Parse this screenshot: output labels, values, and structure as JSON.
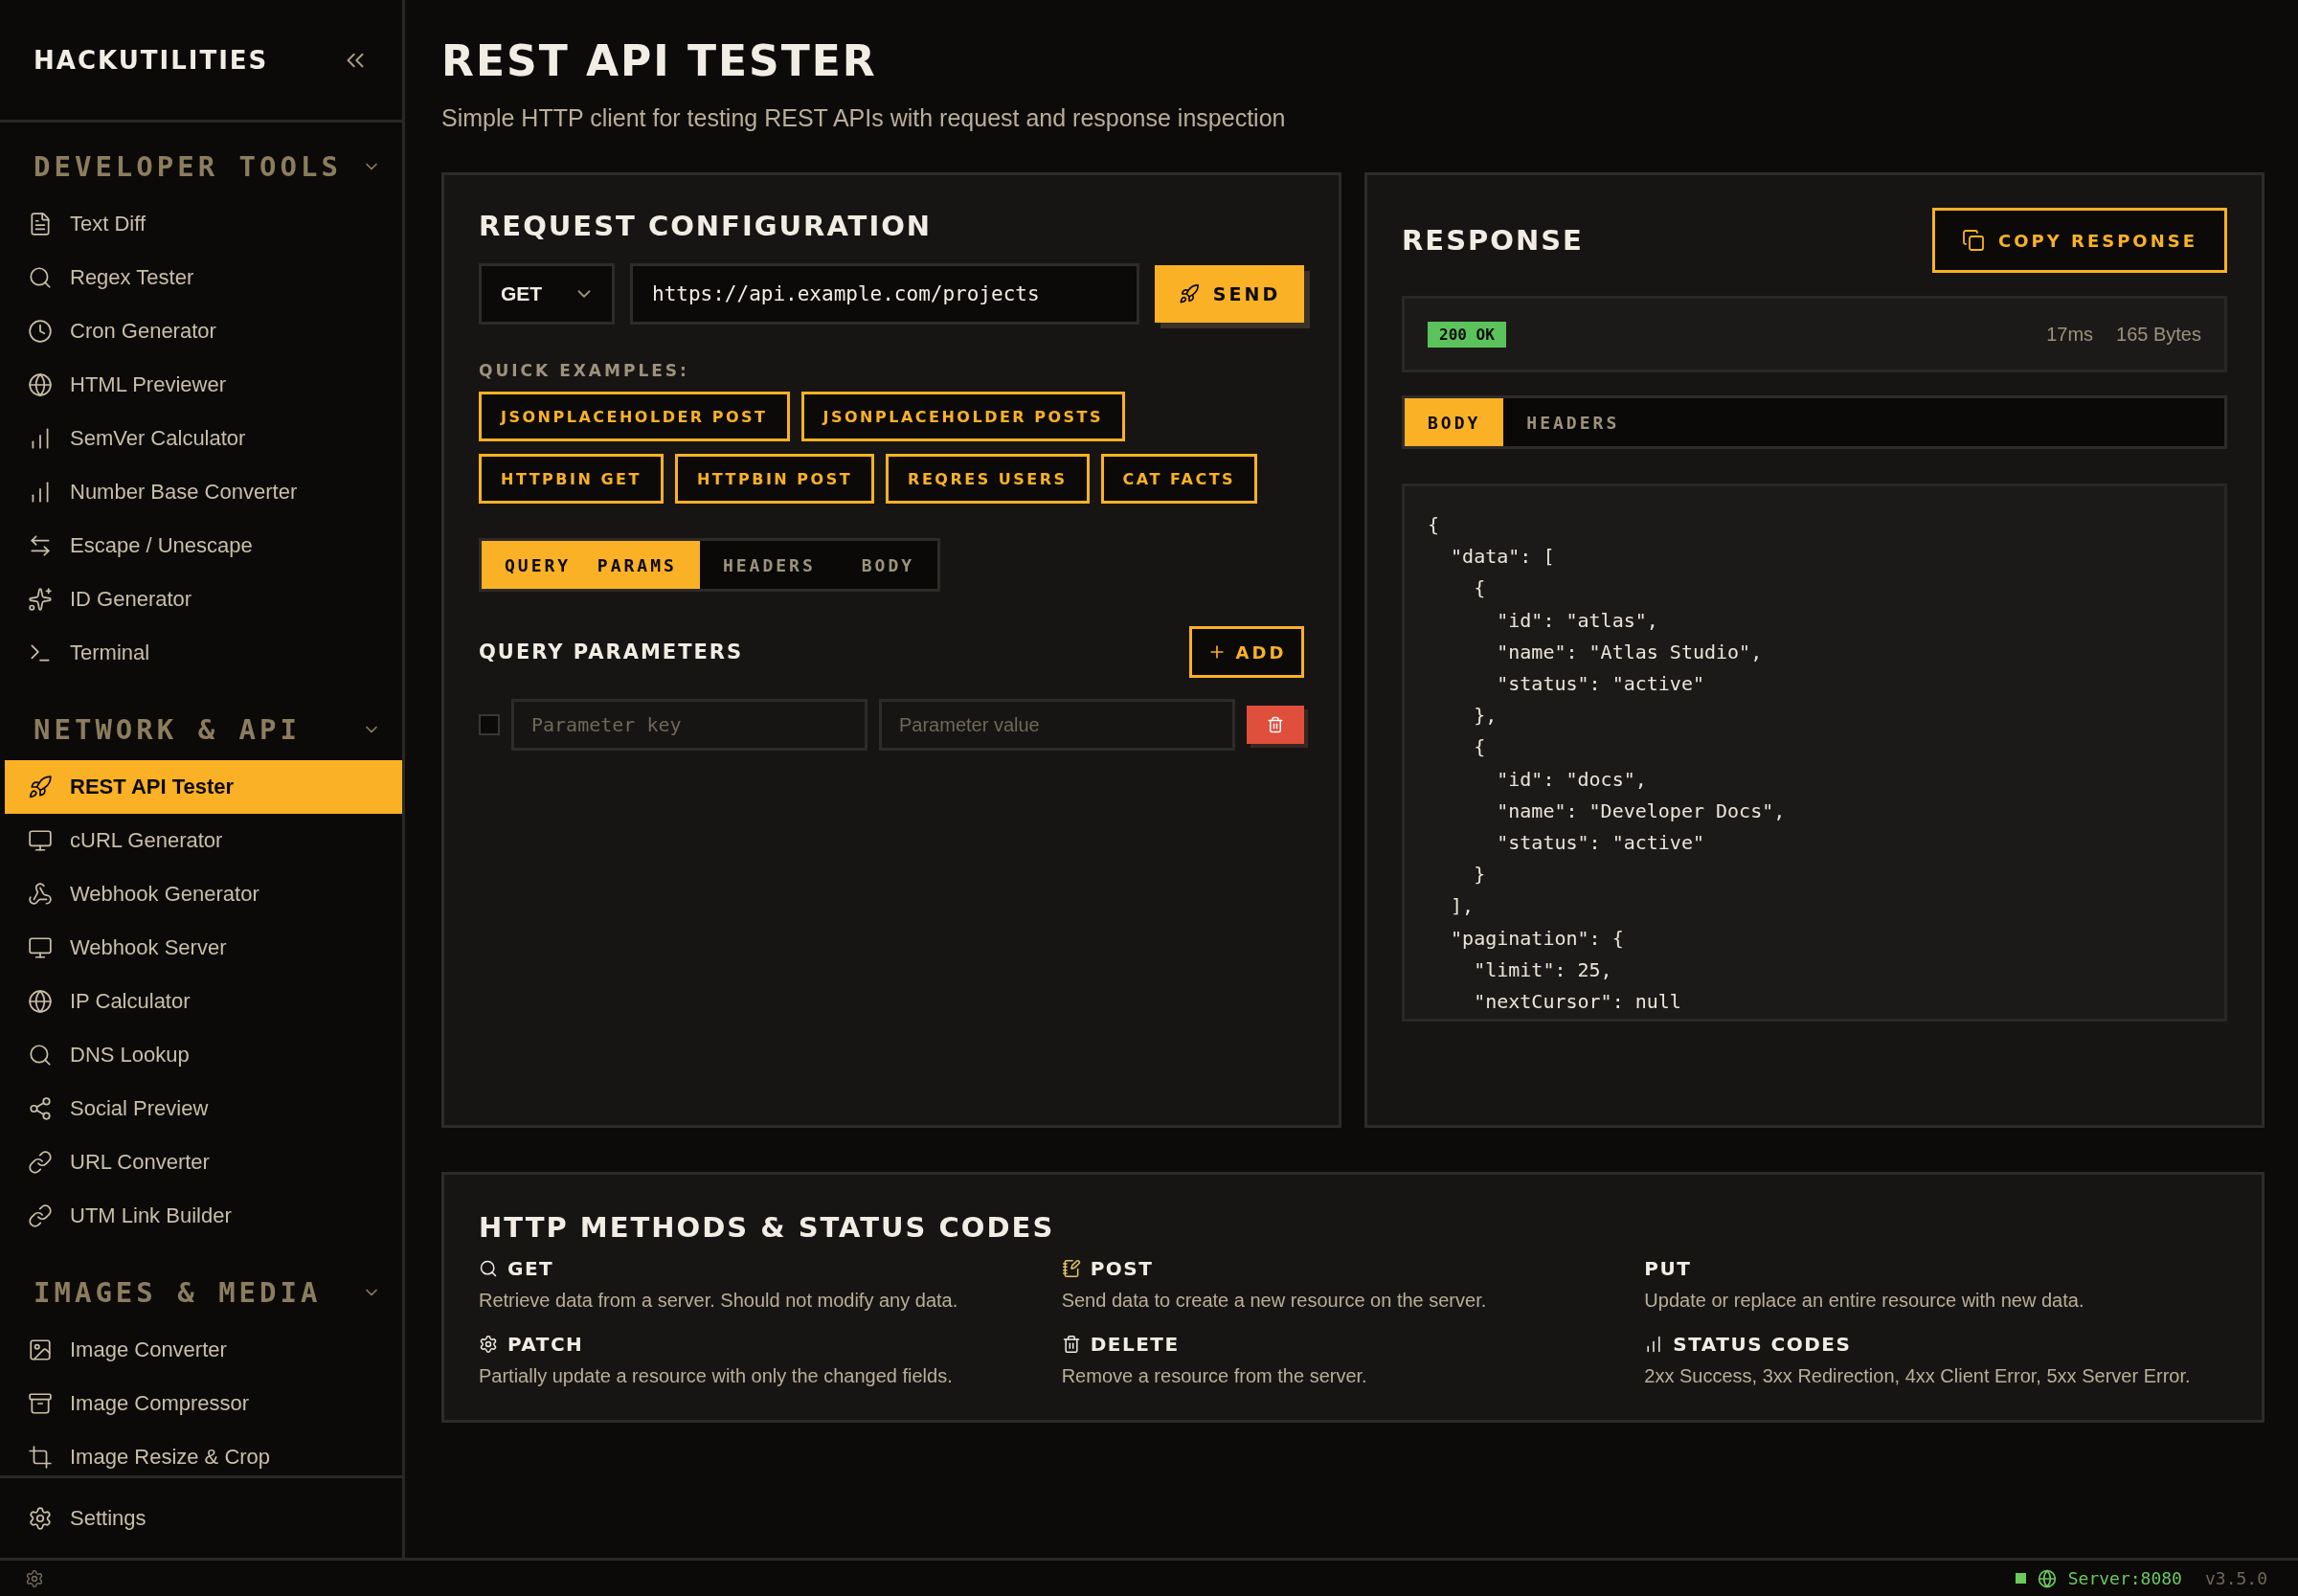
{
  "sidebar": {
    "brand": "HACKUTILITIES",
    "sections": [
      {
        "title": "DEVELOPER TOOLS",
        "expanded": true,
        "items": [
          {
            "label": "Text Diff",
            "selected": false
          },
          {
            "label": "Regex Tester",
            "selected": false
          },
          {
            "label": "Cron Generator",
            "selected": false
          },
          {
            "label": "HTML Previewer",
            "selected": false
          },
          {
            "label": "SemVer Calculator",
            "selected": false
          },
          {
            "label": "Number Base Converter",
            "selected": false
          },
          {
            "label": "Escape / Unescape",
            "selected": false
          },
          {
            "label": "ID Generator",
            "selected": false
          },
          {
            "label": "Terminal",
            "selected": false
          }
        ]
      },
      {
        "title": "NETWORK & API",
        "expanded": true,
        "items": [
          {
            "label": "REST API Tester",
            "selected": true
          },
          {
            "label": "cURL Generator",
            "selected": false
          },
          {
            "label": "Webhook Generator",
            "selected": false
          },
          {
            "label": "Webhook Server",
            "selected": false
          },
          {
            "label": "IP Calculator",
            "selected": false
          },
          {
            "label": "DNS Lookup",
            "selected": false
          },
          {
            "label": "Social Preview",
            "selected": false
          },
          {
            "label": "URL Converter",
            "selected": false
          },
          {
            "label": "UTM Link Builder",
            "selected": false
          }
        ]
      },
      {
        "title": "IMAGES & MEDIA",
        "expanded": true,
        "items": [
          {
            "label": "Image Converter",
            "selected": false
          },
          {
            "label": "Image Compressor",
            "selected": false
          },
          {
            "label": "Image Resize & Crop",
            "selected": false
          }
        ]
      }
    ],
    "settings": "Settings"
  },
  "page": {
    "title": "REST API TESTER",
    "subtitle": "Simple HTTP client for testing REST APIs with request and response inspection"
  },
  "request": {
    "title": "REQUEST CONFIGURATION",
    "method": "GET",
    "url": "https://api.example.com/projects",
    "send": "SEND",
    "quick_label": "QUICK EXAMPLES:",
    "quick_examples": [
      "JSONPLACEHOLDER POST",
      "JSONPLACEHOLDER POSTS",
      "HTTPBIN GET",
      "HTTPBIN POST",
      "REQRES USERS",
      "CAT FACTS"
    ],
    "tabs": [
      {
        "label": "QUERY  PARAMS",
        "selected": true
      },
      {
        "label": "HEADERS",
        "selected": false
      },
      {
        "label": "BODY",
        "selected": false
      }
    ],
    "params_title": "QUERY PARAMETERS",
    "add": "ADD",
    "params": [
      {
        "checked": false,
        "key_placeholder": "Parameter key",
        "value_placeholder": "Parameter value"
      }
    ]
  },
  "response": {
    "title": "RESPONSE",
    "copy": "COPY RESPONSE",
    "status": "200 OK",
    "time": "17ms",
    "size": "165 Bytes",
    "tabs": [
      {
        "label": "BODY",
        "selected": true
      },
      {
        "label": "HEADERS",
        "selected": false
      }
    ],
    "body": "{\n  \"data\": [\n    {\n      \"id\": \"atlas\",\n      \"name\": \"Atlas Studio\",\n      \"status\": \"active\"\n    },\n    {\n      \"id\": \"docs\",\n      \"name\": \"Developer Docs\",\n      \"status\": \"active\"\n    }\n  ],\n  \"pagination\": {\n    \"limit\": 25,\n    \"nextCursor\": null"
  },
  "reference": {
    "title": "HTTP METHODS & STATUS CODES",
    "items": [
      {
        "name": "GET",
        "description": "Retrieve data from a server. Should not modify any data."
      },
      {
        "name": "POST",
        "description": "Send data to create a new resource on the server."
      },
      {
        "name": "PUT",
        "description": "Update or replace an entire resource with new data."
      },
      {
        "name": "PATCH",
        "description": "Partially update a resource with only the changed fields."
      },
      {
        "name": "DELETE",
        "description": "Remove a resource from the server."
      },
      {
        "name": "STATUS CODES",
        "description": "2xx Success, 3xx Redirection, 4xx Client Error, 5xx Server Error."
      }
    ]
  },
  "status_bar": {
    "online": true,
    "server": "Server:8080",
    "version": "v3.5.0"
  }
}
